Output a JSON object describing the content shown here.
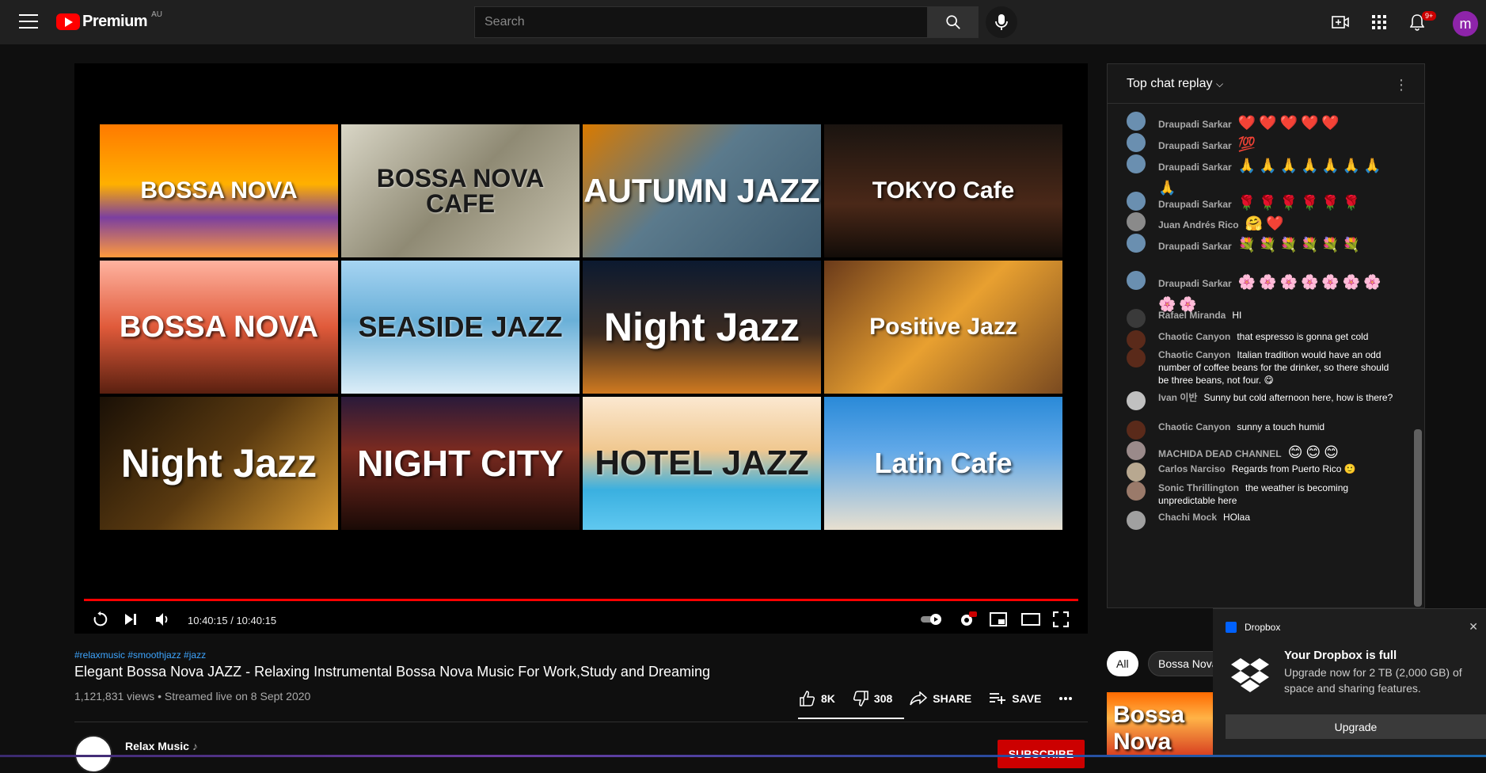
{
  "topbar": {
    "brand": "Premium",
    "region": "AU",
    "search_placeholder": "Search",
    "notifications_badge": "9+",
    "avatar_letter": "m"
  },
  "player": {
    "tiles": [
      {
        "label": "BOSSA NOVA",
        "bg": "linear-gradient(180deg,#ff7a00 0%,#ffb000 45%,#7b3fa0 70%,#ff9a3c 100%)",
        "fs": 30
      },
      {
        "label": "BOSSA NOVA CAFE",
        "bg": "linear-gradient(135deg,#d9d6c6 0%,#8f8a74 50%,#c9c4b0 100%)",
        "fs": 32,
        "dark": true
      },
      {
        "label": "AUTUMN JAZZ",
        "bg": "linear-gradient(135deg,#d97a00 0%,#5b7a8c 45%,#3d5a6e 100%)",
        "fs": 42
      },
      {
        "label": "TOKYO Cafe",
        "bg": "linear-gradient(180deg,#1a1410 0%,#4a2818 60%,#120c08 100%)",
        "fs": 30
      },
      {
        "label": "BOSSA NOVA",
        "bg": "linear-gradient(180deg,#ffb3a0 0%,#e05a3a 50%,#5a2010 100%)",
        "fs": 38
      },
      {
        "label": "SEASIDE JAZZ",
        "bg": "linear-gradient(180deg,#a6d4f2 0%,#6ab0d8 45%,#dceef8 100%)",
        "fs": 36,
        "dark": true
      },
      {
        "label": "Night Jazz",
        "bg": "linear-gradient(180deg,#0c1a30 0%,#3a2a20 55%,#d07a20 100%)",
        "fs": 50
      },
      {
        "label": "Positive Jazz",
        "bg": "linear-gradient(135deg,#6a3a1a 0%,#e8a030 50%,#7a4a20 100%)",
        "fs": 30
      },
      {
        "label": "Night Jazz",
        "bg": "linear-gradient(135deg,#1a1006 0%,#5a3a10 50%,#d89a30 100%)",
        "fs": 50
      },
      {
        "label": "NIGHT CITY",
        "bg": "linear-gradient(180deg,#2a1a3a 0%,#7a2a20 40%,#1a0a06 100%)",
        "fs": 46
      },
      {
        "label": "HOTEL JAZZ",
        "bg": "linear-gradient(180deg,#fbe8d0 0%,#f0c890 40%,#3ab0e0 70%,#60c8f0 100%)",
        "fs": 44,
        "dark": true
      },
      {
        "label": "Latin Cafe",
        "bg": "linear-gradient(180deg,#2a8ad8 0%,#60a8e8 40%,#e8e0d0 100%)",
        "fs": 36
      }
    ],
    "time_display": "10:40:15 / 10:40:15",
    "progress_pct": 100
  },
  "video": {
    "hashtags": "#relaxmusic #smoothjazz #jazz",
    "title": "Elegant Bossa Nova JAZZ - Relaxing Instrumental Bossa Nova Music For Work,Study and Dreaming",
    "meta": "1,121,831 views • Streamed live on 8 Sept 2020",
    "likes": "8K",
    "dislikes": "308",
    "share_label": "SHARE",
    "save_label": "SAVE",
    "channel_name": "Relax Music",
    "channel_note": "♪",
    "subscribe_label": "SUBSCRIBE"
  },
  "chat": {
    "header": "Top chat replay",
    "messages": [
      {
        "name": "Draupadi Sarkar",
        "text": "❤️❤️❤️❤️❤️",
        "emoji": true,
        "color": "#6a8fb0"
      },
      {
        "name": "Draupadi Sarkar",
        "text": "💯",
        "emoji": true,
        "color": "#6a8fb0"
      },
      {
        "name": "Draupadi Sarkar",
        "text": "🙏🙏🙏🙏🙏🙏🙏🙏",
        "emoji": true,
        "color": "#6a8fb0"
      },
      {
        "name": "Draupadi Sarkar",
        "text": "🌹🌹🌹🌹🌹🌹",
        "emoji": true,
        "color": "#6a8fb0"
      },
      {
        "name": "Juan Andrés Rico",
        "text": "🤗❤️",
        "emoji": true,
        "color": "#8a8a8a"
      },
      {
        "name": "Draupadi Sarkar",
        "text": "💐💐💐💐💐💐",
        "emoji": true,
        "color": "#6a8fb0"
      },
      {
        "name": "Draupadi Sarkar",
        "text": "🌸🌸🌸🌸🌸🌸🌸🌸🌸",
        "emoji": true,
        "color": "#6a8fb0"
      },
      {
        "name": "Rafael Miranda",
        "text": "HI",
        "emoji": false,
        "color": "#3a3a3a"
      },
      {
        "name": "Chaotic Canyon",
        "text": "that espresso is gonna get cold",
        "emoji": false,
        "color": "#5a2a1a"
      },
      {
        "name": "Chaotic Canyon",
        "text": "Italian tradition would have an odd number of coffee beans for the drinker, so there should be three beans, not four. 😋",
        "emoji": false,
        "color": "#5a2a1a"
      },
      {
        "name": "Ivan 이반",
        "text": "Sunny but cold afternoon here, how is there?",
        "emoji": false,
        "color": "#c0c0c0"
      },
      {
        "name": "Chaotic Canyon",
        "text": "sunny a touch humid",
        "emoji": false,
        "color": "#5a2a1a"
      },
      {
        "name": "MACHIDA DEAD CHANNEL",
        "text": "😊😊😊",
        "emoji": true,
        "color": "#9a8a8a"
      },
      {
        "name": "Carlos Narciso",
        "text": "Regards from Puerto Rico 🙂",
        "emoji": false,
        "color": "#b8a890"
      },
      {
        "name": "Sonic Thrillington",
        "text": "the weather is becoming unpredictable here",
        "emoji": false,
        "color": "#9a7a6a"
      },
      {
        "name": "Chachi Mock",
        "text": "HOlaa",
        "emoji": false,
        "color": "#a0a0a0"
      }
    ]
  },
  "chips": {
    "all": "All",
    "second": "Bossa Nova"
  },
  "recommended": {
    "thumb_text": "Bossa Nova"
  },
  "dropbox": {
    "app": "Dropbox",
    "title": "Your Dropbox is full",
    "text": "Upgrade now for 2 TB (2,000 GB) of space and sharing features.",
    "button": "Upgrade"
  }
}
